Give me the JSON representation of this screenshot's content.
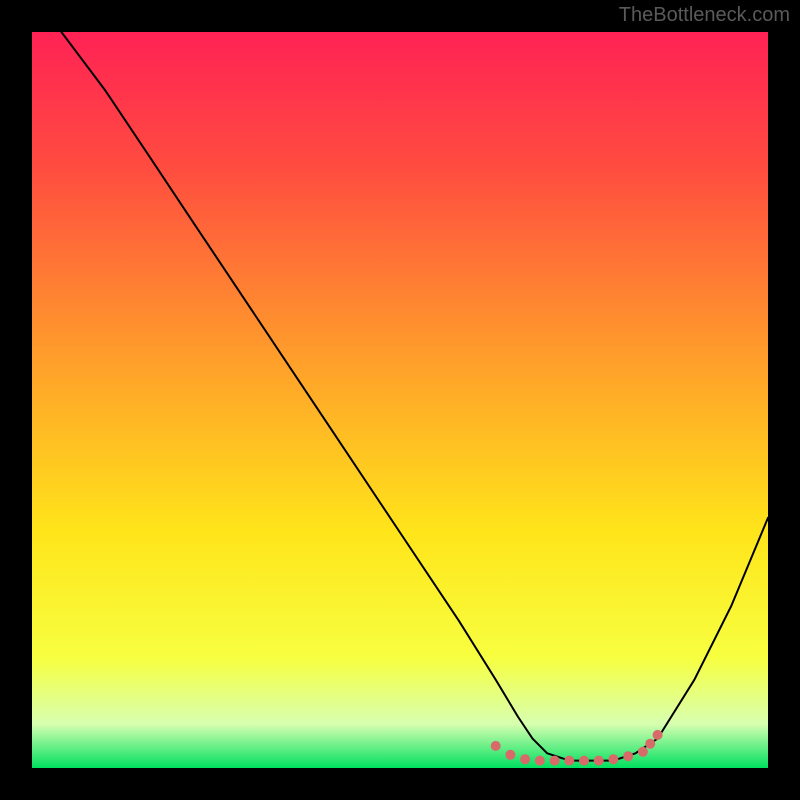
{
  "watermark": "TheBottleneck.com",
  "chart_data": {
    "type": "line",
    "title": "",
    "xlabel": "",
    "ylabel": "",
    "xlim": [
      0,
      100
    ],
    "ylim": [
      0,
      100
    ],
    "grid": false,
    "legend": false,
    "gradient_stops": [
      {
        "offset": 0,
        "color": "#ff2255"
      },
      {
        "offset": 18,
        "color": "#ff4b40"
      },
      {
        "offset": 45,
        "color": "#ffa02a"
      },
      {
        "offset": 68,
        "color": "#ffe51a"
      },
      {
        "offset": 85,
        "color": "#f7ff40"
      },
      {
        "offset": 94,
        "color": "#d8ffb0"
      },
      {
        "offset": 100,
        "color": "#00e060"
      }
    ],
    "series": [
      {
        "name": "curve",
        "color": "#000000",
        "width": 2,
        "x": [
          4,
          10,
          16,
          22,
          30,
          40,
          50,
          58,
          63,
          66,
          68,
          70,
          73,
          76,
          79,
          82,
          85,
          90,
          95,
          100
        ],
        "y": [
          100,
          92,
          83,
          74,
          62,
          47,
          32,
          20,
          12,
          7,
          4,
          2,
          1,
          1,
          1,
          2,
          4,
          12,
          22,
          34
        ]
      },
      {
        "name": "markers",
        "type": "scatter",
        "color": "#d86a6a",
        "radius": 5,
        "x": [
          63,
          65,
          67,
          69,
          71,
          73,
          75,
          77,
          79,
          81,
          83,
          84,
          85
        ],
        "y": [
          3.0,
          1.8,
          1.2,
          1.0,
          1.0,
          1.0,
          1.0,
          1.0,
          1.2,
          1.6,
          2.2,
          3.3,
          4.5
        ]
      }
    ]
  }
}
